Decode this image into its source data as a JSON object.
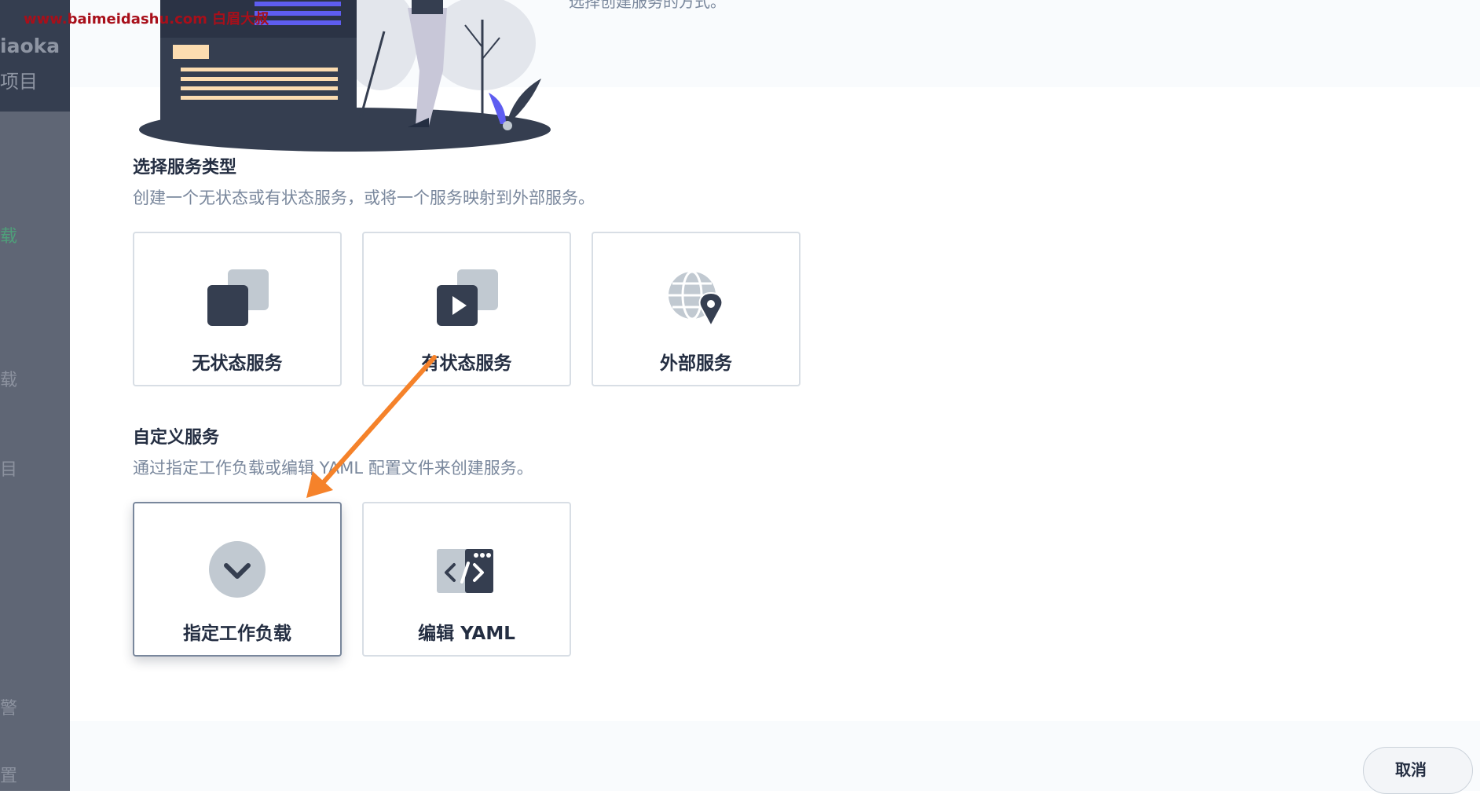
{
  "watermark": "www.baimeidashu.com 白眉大叔",
  "sidebar": {
    "title": "iaoka",
    "subtitle": "项目",
    "items": [
      {
        "label": "载",
        "active": true
      },
      {
        "label": "载",
        "active": false
      },
      {
        "label": "目",
        "active": false
      },
      {
        "label": "警",
        "active": false
      },
      {
        "label": "置",
        "active": false
      }
    ]
  },
  "modal": {
    "top_text": "选择创建服务的方式。",
    "section1": {
      "title": "选择服务类型",
      "desc": "创建一个无状态或有状态服务，或将一个服务映射到外部服务。",
      "cards": [
        {
          "label": "无状态服务",
          "icon": "stateless-service-icon"
        },
        {
          "label": "有状态服务",
          "icon": "stateful-service-icon"
        },
        {
          "label": "外部服务",
          "icon": "external-service-icon"
        }
      ]
    },
    "section2": {
      "title": "自定义服务",
      "desc": "通过指定工作负载或编辑 YAML 配置文件来创建服务。",
      "cards": [
        {
          "label": "指定工作负载",
          "icon": "specify-workload-icon",
          "selected": true
        },
        {
          "label": "编辑 YAML",
          "icon": "edit-yaml-icon",
          "selected": false
        }
      ]
    },
    "footer": {
      "cancel_label": "取消"
    }
  },
  "colors": {
    "text_dark": "#242e42",
    "text_muted": "#79879c",
    "icon_light": "#c1c9d1",
    "annotation_arrow": "#f5822a",
    "accent_purple": "#5e5df0"
  }
}
